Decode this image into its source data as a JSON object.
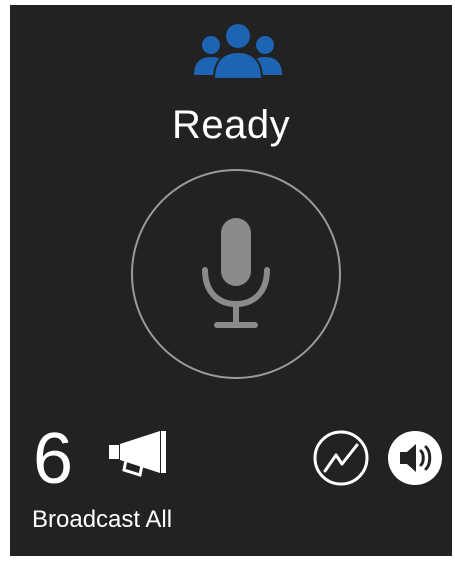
{
  "header": {
    "group_icon": "group-users-icon",
    "group_icon_color": "#1e64b4"
  },
  "status": {
    "label": "Ready"
  },
  "ptt": {
    "icon": "microphone-icon",
    "icon_color": "#8a8a8a",
    "ring_color": "#9a9a9a"
  },
  "footer": {
    "count": "6",
    "broadcast_icon": "megaphone-icon",
    "target_label": "Broadcast All",
    "stats_icon": "line-graph-icon",
    "speaker_icon": "speaker-volume-icon"
  },
  "colors": {
    "panel_background": "#222222",
    "text": "#ffffff"
  }
}
